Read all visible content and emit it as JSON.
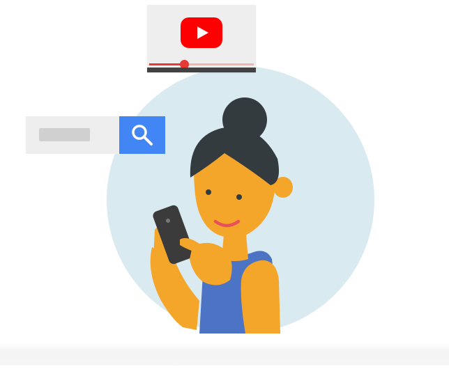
{
  "scene": {
    "description_icon": "person-with-phone-illustration"
  },
  "video": {
    "icon": "youtube-play-icon",
    "progress": 0.33,
    "colors": {
      "card": "#eeeeee",
      "play": "#ff0000",
      "progress": "#e53935",
      "bar": "#424242"
    }
  },
  "search": {
    "value": "",
    "placeholder": "",
    "icon": "search-icon",
    "colors": {
      "field": "#d0d0d0",
      "button": "#4285f4"
    }
  },
  "colors": {
    "circle": "#d9eaf0",
    "skin": "#f4a62a",
    "hair": "#333b3e",
    "shirt": "#4d74c4",
    "phone": "#3b3b3b"
  }
}
